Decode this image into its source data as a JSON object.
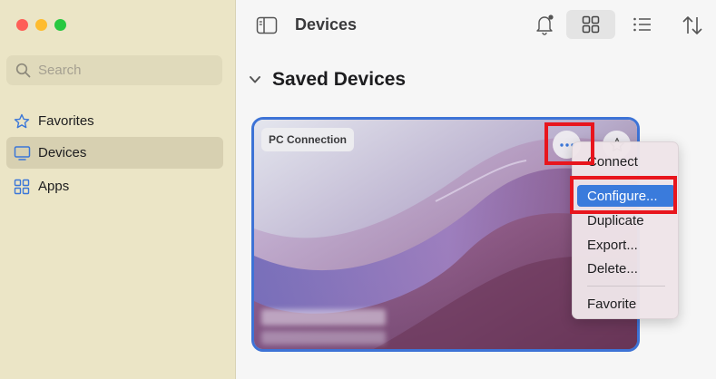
{
  "sidebar": {
    "search_placeholder": "Search",
    "items": [
      {
        "label": "Favorites",
        "icon": "star-icon"
      },
      {
        "label": "Devices",
        "icon": "monitor-icon",
        "active": true
      },
      {
        "label": "Apps",
        "icon": "apps-icon"
      }
    ]
  },
  "toolbar": {
    "title": "Devices",
    "icons": [
      "sidebar-toggle-icon",
      "bell-icon",
      "grid-view-icon",
      "list-view-icon",
      "sort-icon"
    ]
  },
  "section": {
    "title": "Saved Devices"
  },
  "card": {
    "badge": "PC Connection"
  },
  "context_menu": {
    "items": [
      {
        "label": "Connect"
      },
      {
        "label": "Configure...",
        "selected": true
      },
      {
        "label": "Duplicate"
      },
      {
        "label": "Export..."
      },
      {
        "label": "Delete..."
      },
      {
        "label": "Favorite"
      }
    ]
  },
  "colors": {
    "accent": "#3a7bdc",
    "highlight": "#e8151d",
    "sidebar_bg": "#ebe5c6"
  }
}
